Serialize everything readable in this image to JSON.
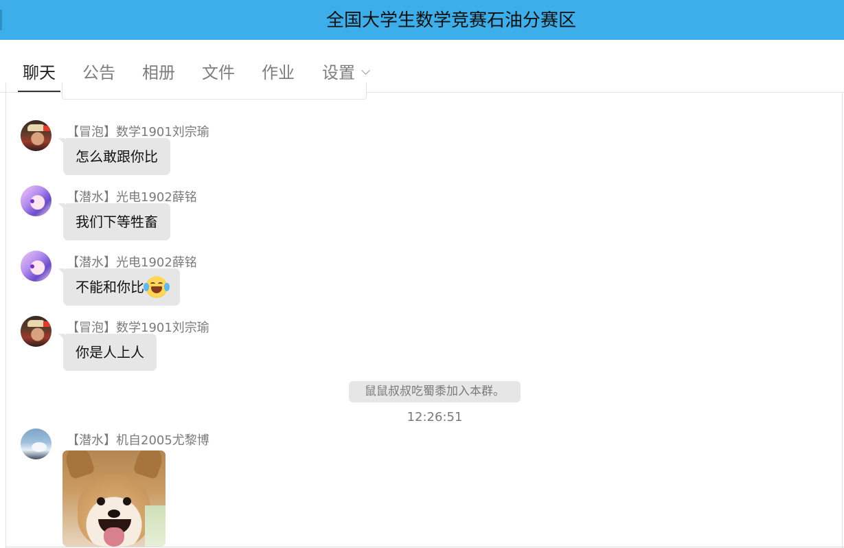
{
  "window": {
    "title": "全国大学生数学竞赛石油分赛区"
  },
  "tabs": [
    {
      "label": "聊天",
      "active": true
    },
    {
      "label": "公告",
      "active": false
    },
    {
      "label": "相册",
      "active": false
    },
    {
      "label": "文件",
      "active": false
    },
    {
      "label": "作业",
      "active": false
    },
    {
      "label": "设置",
      "active": false,
      "icon": "chevron-down-icon"
    }
  ],
  "messages": [
    {
      "sender": "【冒泡】数学1901刘宗瑜",
      "text": "怎么敢跟你比",
      "avatar": "avatar-hat"
    },
    {
      "sender": "【潜水】光电1902薛铭",
      "text": "我们下等牲畜",
      "avatar": "avatar-anime"
    },
    {
      "sender": "【潜水】光电1902薛铭",
      "text": "不能和你比",
      "emoji": "tears-of-joy-emoji",
      "avatar": "avatar-anime"
    },
    {
      "sender": "【冒泡】数学1901刘宗瑜",
      "text": "你是人上人",
      "avatar": "avatar-hat"
    },
    {
      "sender": "【潜水】机自2005尤黎博",
      "image": "corgi-sticker",
      "avatar": "avatar-sky"
    }
  ],
  "system_notice": {
    "text": "鼠鼠叔叔吃蜀黍加入本群。",
    "time": "12:26:51"
  },
  "colors": {
    "title_bar": "#3daee9",
    "bubble": "#e6e6e6",
    "muted_text": "#7a7a7a"
  }
}
